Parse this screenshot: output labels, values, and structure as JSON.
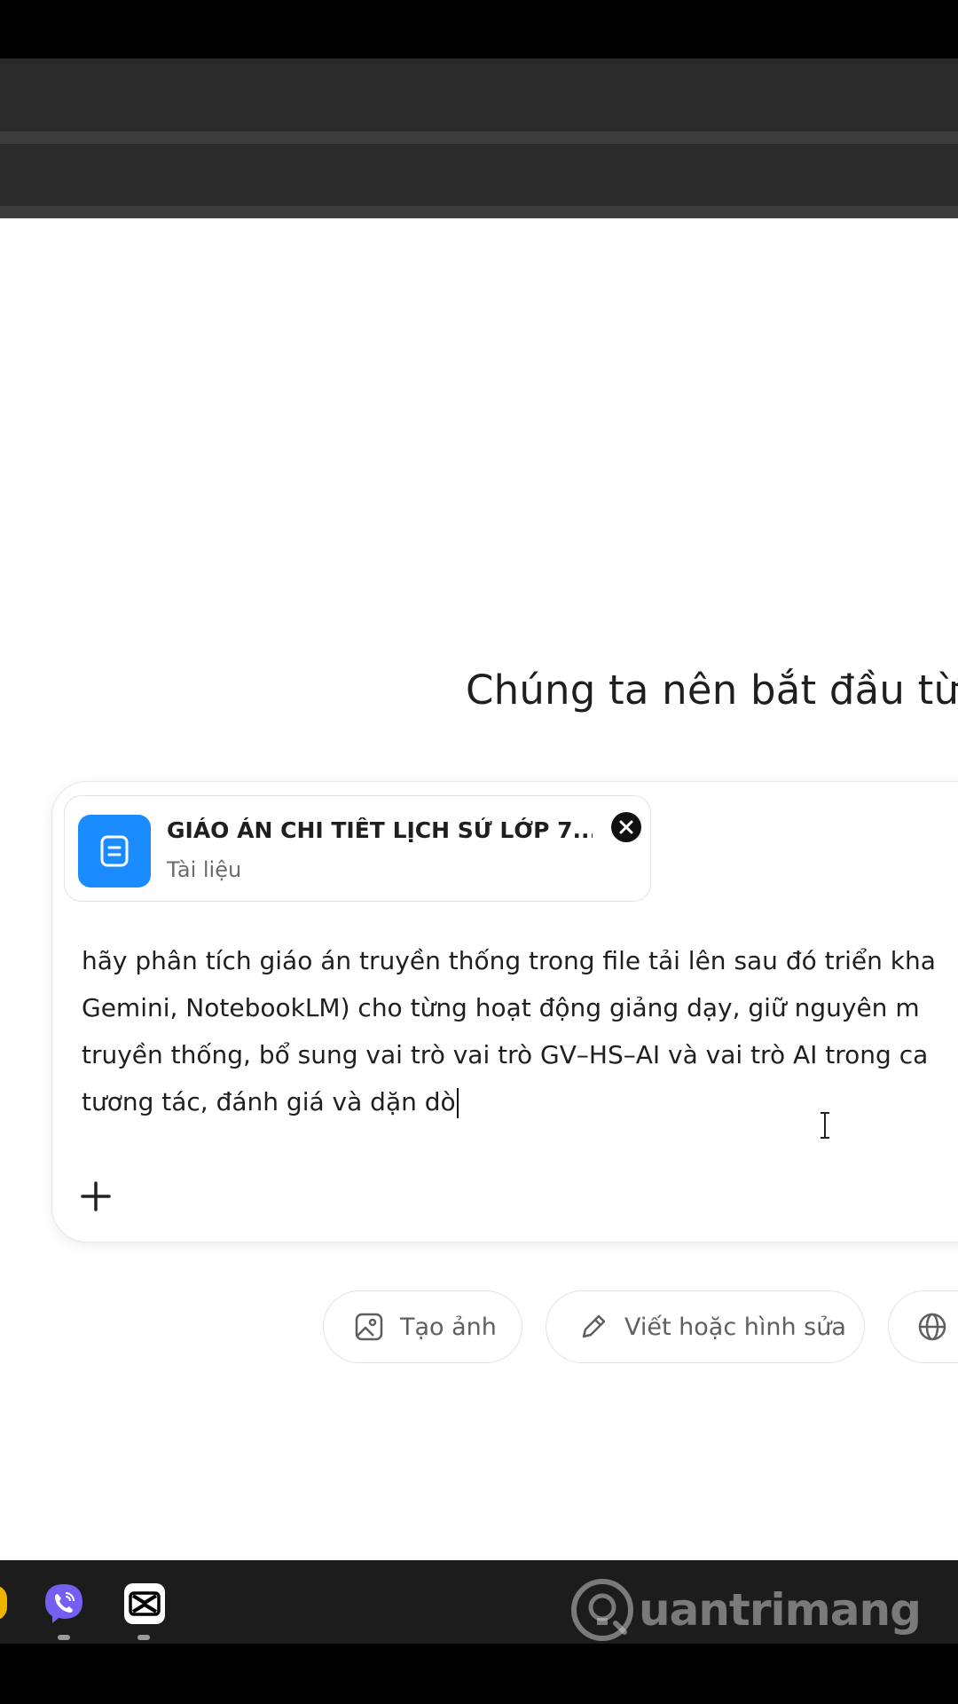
{
  "page": {
    "greeting": "Chúng ta nên bắt đầu từ đ"
  },
  "attachment": {
    "title": "GIÁO ÁN CHI TIẾT LỊCH SỬ LỚP 7....",
    "subtitle": "Tài liệu",
    "icon": "document-icon",
    "remove_icon": "close-icon"
  },
  "prompt": {
    "lines": [
      "hãy phân tích giáo án truyền thống trong file tải lên sau đó triển kha",
      "Gemini, NotebookLM) cho từng hoạt động giảng dạy, giữ nguyên m",
      "truyền thống, bổ sung vai trò vai trò GV–HS–AI và vai trò AI trong ca",
      "tương tác, đánh giá và dặn dò"
    ]
  },
  "composer": {
    "add_icon": "plus-icon"
  },
  "chips": [
    {
      "label": "Tạo ảnh",
      "icon": "image-icon"
    },
    {
      "label": "Viết hoặc hình sửa",
      "icon": "pencil-icon"
    },
    {
      "label": "",
      "icon": "globe-icon"
    }
  ],
  "taskbar": {
    "apps": [
      "viber-icon",
      "capcut-icon"
    ]
  },
  "watermark": {
    "text": "uantrimang"
  },
  "colors": {
    "doc_tile": "#1a8cff",
    "viber": "#7360f2",
    "chrome": "#2a2a2a",
    "taskbar": "#1c1c1c"
  }
}
